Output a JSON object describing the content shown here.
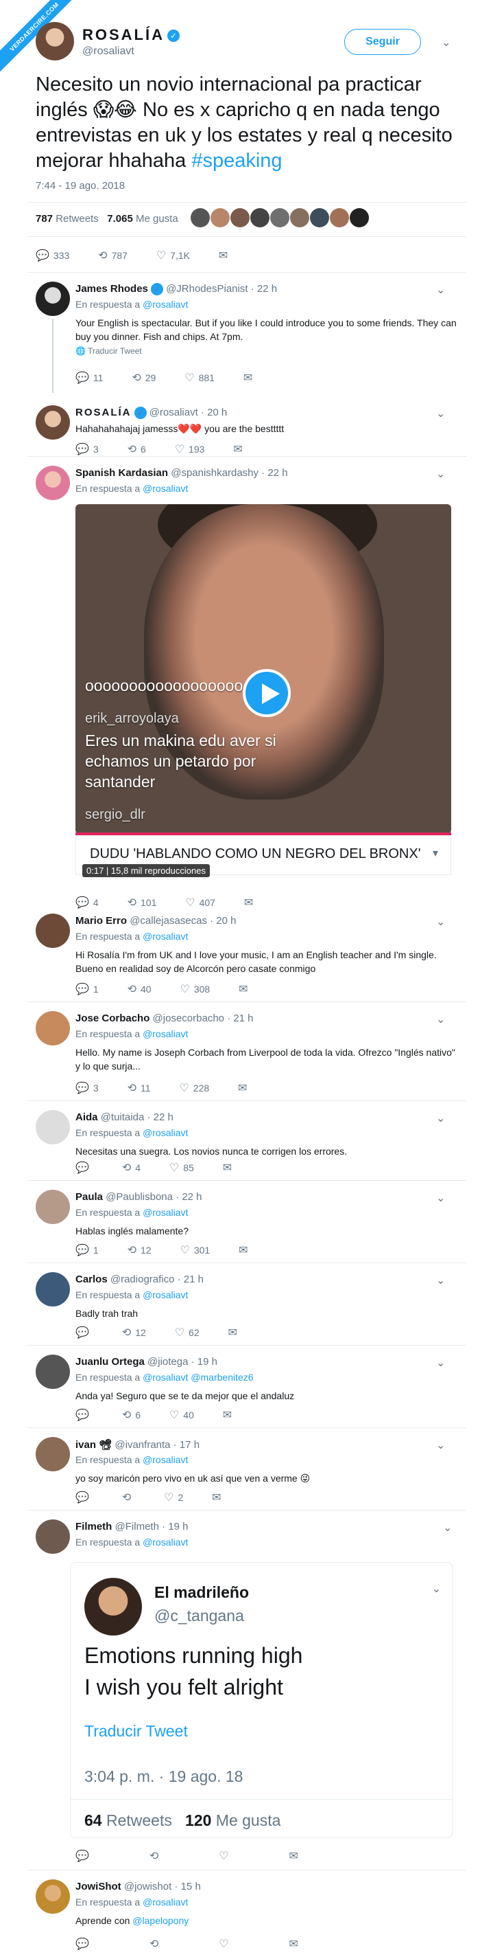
{
  "badge": "VERDAERCIRE.COM",
  "main_tweet": {
    "name": "ROSALÍA",
    "handle": "@rosaliavt",
    "follow_label": "Seguir",
    "text": "Necesito un novio internacional pa practicar inglés 😱😂 No es x capricho q en nada tengo entrevistas en uk y los estates y real q necesito mejorar hhahaha ",
    "hashtag": "#speaking",
    "timestamp": "7:44 - 19 ago. 2018",
    "retweets_count": "787",
    "retweets_label": "Retweets",
    "likes_count": "7.065",
    "likes_label": "Me gusta",
    "replies": "333",
    "rts": "787",
    "likes": "7,1K"
  },
  "replies": [
    {
      "name": "James Rhodes",
      "handle": "@JRhodesPianist · 22 h",
      "in_reply": "En respuesta a",
      "to": "@rosaliavt",
      "text": "Your English is spectacular. But if you like I could introduce you to some friends. They can buy you dinner. Fish and chips. At 7pm.",
      "translate": "Traducir Tweet",
      "r": "11",
      "rt": "29",
      "lk": "881"
    },
    {
      "name": "ROSALÍA",
      "handle": "@rosaliavt · 20 h",
      "text": "Hahahahahajaj jamesss❤️❤️ you are the besttttt",
      "r": "3",
      "rt": "6",
      "lk": "193"
    },
    {
      "name": "Spanish Kardasian",
      "handle": "@spanishkardashy · 22 h",
      "in_reply": "En respuesta a",
      "to": "@rosaliavt",
      "r": "4",
      "rt": "101",
      "lk": "407"
    },
    {
      "name": "Mario Erro",
      "handle": "@callejasasecas · 20 h",
      "in_reply": "En respuesta a",
      "to": "@rosaliavt",
      "text": "Hi Rosalía I'm from UK and I love your music, I am an English teacher and I'm single. Bueno en realidad soy de Alcorcón pero casate conmigo",
      "r": "1",
      "rt": "40",
      "lk": "308"
    },
    {
      "name": "Jose Corbacho",
      "handle": "@josecorbacho · 21 h",
      "in_reply": "En respuesta a",
      "to": "@rosaliavt",
      "text": "Hello. My name is Joseph Corbach from Liverpool de toda la vida. Ofrezco \"Inglés nativo\" y lo que surja...",
      "r": "3",
      "rt": "11",
      "lk": "228"
    },
    {
      "name": "Aida",
      "handle": "@tuitaida · 22 h",
      "in_reply": "En respuesta a",
      "to": "@rosaliavt",
      "text": "Necesitas una suegra. Los novios nunca te corrigen los errores.",
      "r": "",
      "rt": "4",
      "lk": "85"
    },
    {
      "name": "Paula",
      "handle": "@Paublisbona · 22 h",
      "in_reply": "En respuesta a",
      "to": "@rosaliavt",
      "text": "Hablas inglés malamente?",
      "r": "1",
      "rt": "12",
      "lk": "301"
    },
    {
      "name": "Carlos",
      "handle": "@radiografico · 21 h",
      "in_reply": "En respuesta a",
      "to": "@rosaliavt",
      "text": "Badly trah trah",
      "r": "",
      "rt": "12",
      "lk": "62"
    },
    {
      "name": "Juanlu Ortega",
      "handle": "@jiotega · 19 h",
      "in_reply": "En respuesta a",
      "to": "@rosaliavt @marbenitez6",
      "text": "Anda ya! Seguro que se te da mejor que el andaluz",
      "r": "",
      "rt": "6",
      "lk": "40"
    },
    {
      "name": "ivan 📽",
      "handle": "@ivanfranta · 17 h",
      "in_reply": "En respuesta a",
      "to": "@rosaliavt",
      "text": "yo soy maricón pero vivo en uk así que ven a verme 😜",
      "r": "",
      "rt": "",
      "lk": "2"
    },
    {
      "name": "Filmeth",
      "handle": "@Filmeth · 19 h",
      "in_reply": "En respuesta a",
      "to": "@rosaliavt"
    },
    {
      "name": "JowiShot",
      "handle": "@jowishot · 15 h",
      "in_reply": "En respuesta a",
      "to": "@rosaliavt",
      "text_pre": "Aprende con ",
      "text_link": "@lapelopony"
    }
  ],
  "video": {
    "chat": [
      "oooooooooooooooooo",
      "erik_arroyolaya",
      "Eres un makina edu aver si",
      "echamos un petardo por",
      "santander",
      "sergio_dlr"
    ],
    "caption": "DUDU 'HABLANDO COMO UN NEGRO DEL BRONX'",
    "time": "0:17",
    "views": "15,8 mil reproducciones"
  },
  "quote": {
    "name": "El madrileño",
    "handle": "@c_tangana",
    "line1": "Emotions running high",
    "line2": "I wish you felt alright",
    "translate": "Traducir Tweet",
    "date": "3:04 p. m. · 19 ago. 18",
    "rt_count": "64",
    "rt_label": "Retweets",
    "like_count": "120",
    "like_label": "Me gusta"
  }
}
